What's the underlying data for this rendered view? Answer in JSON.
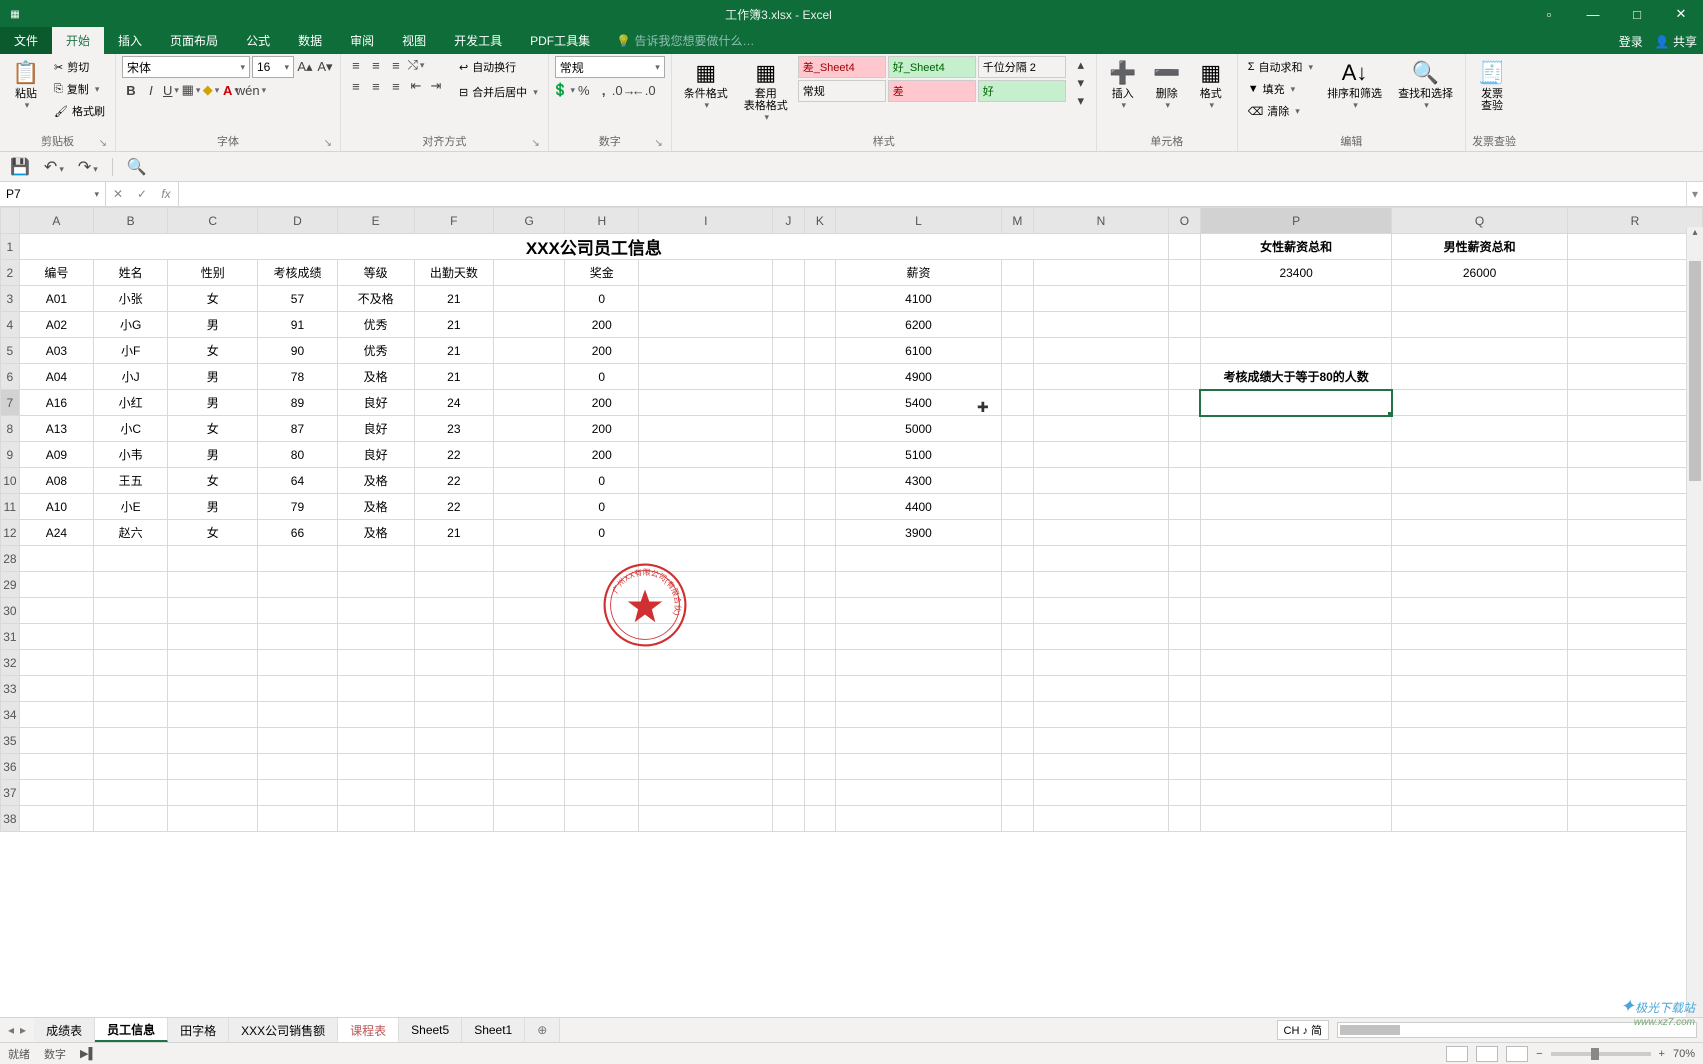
{
  "title": "工作簿3.xlsx - Excel",
  "tabs": {
    "file": "文件",
    "home": "开始",
    "insert": "插入",
    "layout": "页面布局",
    "formula": "公式",
    "data": "数据",
    "review": "审阅",
    "view": "视图",
    "dev": "开发工具",
    "pdf": "PDF工具集"
  },
  "tellme": "告诉我您想要做什么…",
  "signin": "登录",
  "share": "共享",
  "clipboard": {
    "label": "剪贴板",
    "paste": "粘贴",
    "cut": "剪切",
    "copy": "复制",
    "painter": "格式刷"
  },
  "font": {
    "label": "字体",
    "name": "宋体",
    "size": "16"
  },
  "align": {
    "label": "对齐方式",
    "wrap": "自动换行",
    "merge": "合并后居中"
  },
  "number": {
    "label": "数字",
    "format": "常规"
  },
  "styles": {
    "label": "样式",
    "cond": "条件格式",
    "fmt": "套用\n表格格式",
    "cells": [
      "差_Sheet4",
      "好_Sheet4",
      "千位分隔 2",
      "常规",
      "差",
      "好"
    ]
  },
  "cells_grp": {
    "label": "单元格",
    "insert": "插入",
    "delete": "删除",
    "format": "格式"
  },
  "editing": {
    "label": "编辑",
    "sum": "自动求和",
    "fill": "填充",
    "clear": "清除",
    "sort": "排序和筛选",
    "find": "查找和选择"
  },
  "invoice": {
    "label": "发票查验",
    "btn": "发票\n查验"
  },
  "namebox": "P7",
  "columns": [
    "A",
    "B",
    "C",
    "D",
    "E",
    "F",
    "G",
    "H",
    "I",
    "J",
    "K",
    "L",
    "M",
    "N",
    "O",
    "P",
    "Q",
    "R"
  ],
  "widths": [
    88,
    88,
    108,
    88,
    88,
    88,
    88,
    88,
    170,
    38,
    38,
    204,
    38,
    170,
    38,
    204,
    204,
    170
  ],
  "row_nums": [
    "1",
    "2",
    "3",
    "4",
    "5",
    "6",
    "7",
    "8",
    "9",
    "10",
    "11",
    "12",
    "28",
    "29",
    "30",
    "31",
    "32",
    "33",
    "34",
    "35",
    "36",
    "37",
    "38"
  ],
  "merged_title": "XXX公司员工信息",
  "headers": [
    "编号",
    "姓名",
    "性别",
    "考核成绩",
    "等级",
    "出勤天数",
    "",
    "奖金",
    "",
    "",
    "",
    "薪资"
  ],
  "side": {
    "female": "女性薪资总和",
    "male": "男性薪资总和",
    "fval": "23400",
    "mval": "26000",
    "cnt_label": "考核成绩大于等于80的人数"
  },
  "data_rows": [
    [
      "A01",
      "小张",
      "女",
      "57",
      "不及格",
      "21",
      "",
      "0",
      "",
      "",
      "",
      "4100"
    ],
    [
      "A02",
      "小G",
      "男",
      "91",
      "优秀",
      "21",
      "",
      "200",
      "",
      "",
      "",
      "6200"
    ],
    [
      "A03",
      "小F",
      "女",
      "90",
      "优秀",
      "21",
      "",
      "200",
      "",
      "",
      "",
      "6100"
    ],
    [
      "A04",
      "小J",
      "男",
      "78",
      "及格",
      "21",
      "",
      "0",
      "",
      "",
      "",
      "4900"
    ],
    [
      "A16",
      "小红",
      "男",
      "89",
      "良好",
      "24",
      "",
      "200",
      "",
      "",
      "",
      "5400"
    ],
    [
      "A13",
      "小C",
      "女",
      "87",
      "良好",
      "23",
      "",
      "200",
      "",
      "",
      "",
      "5000"
    ],
    [
      "A09",
      "小韦",
      "男",
      "80",
      "良好",
      "22",
      "",
      "200",
      "",
      "",
      "",
      "5100"
    ],
    [
      "A08",
      "王五",
      "女",
      "64",
      "及格",
      "22",
      "",
      "0",
      "",
      "",
      "",
      "4300"
    ],
    [
      "A10",
      "小E",
      "男",
      "79",
      "及格",
      "22",
      "",
      "0",
      "",
      "",
      "",
      "4400"
    ],
    [
      "A24",
      "赵六",
      "女",
      "66",
      "及格",
      "21",
      "",
      "0",
      "",
      "",
      "",
      "3900"
    ]
  ],
  "sheets": [
    "成绩表",
    "员工信息",
    "田字格",
    "XXX公司销售额",
    "课程表",
    "Sheet5",
    "Sheet1"
  ],
  "active_sheet": 1,
  "hl_sheet": 4,
  "ime": "CH ♪ 简",
  "status": {
    "ready": "就绪",
    "mode": "数字"
  },
  "zoom": "70%",
  "stamp_text": "广州XX有限公司(有限合伙)",
  "watermark": {
    "a": "极光下载站",
    "b": "www.xz7.com"
  }
}
